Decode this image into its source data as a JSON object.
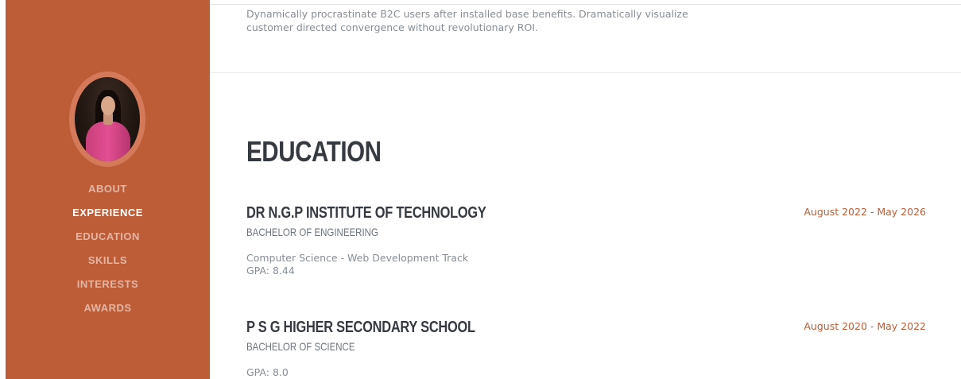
{
  "nav": {
    "items": [
      {
        "label": "ABOUT",
        "active": false
      },
      {
        "label": "EXPERIENCE",
        "active": true
      },
      {
        "label": "EDUCATION",
        "active": false
      },
      {
        "label": "SKILLS",
        "active": false
      },
      {
        "label": "INTERESTS",
        "active": false
      },
      {
        "label": "AWARDS",
        "active": false
      }
    ]
  },
  "about": {
    "text": "Dynamically procrastinate B2C users after installed base benefits. Dramatically visualize customer directed convergence without revolutionary ROI."
  },
  "education": {
    "title": "EDUCATION",
    "entries": [
      {
        "school": "DR N.G.P INSTITUTE OF TECHNOLOGY",
        "degree": "BACHELOR OF ENGINEERING",
        "description_line1": "Computer Science - Web Development Track",
        "description_line2": "GPA: 8.44",
        "date": "August 2022 - May 2026"
      },
      {
        "school": "P S G HIGHER SECONDARY SCHOOL",
        "degree": "BACHELOR OF SCIENCE",
        "description_line1": "GPA: 8.0",
        "date": "August 2020 - May 2022"
      }
    ]
  },
  "colors": {
    "sidebar_bg": "#bd5d38",
    "accent": "#bd5d38",
    "heading": "#343a40",
    "muted": "#868e96"
  }
}
